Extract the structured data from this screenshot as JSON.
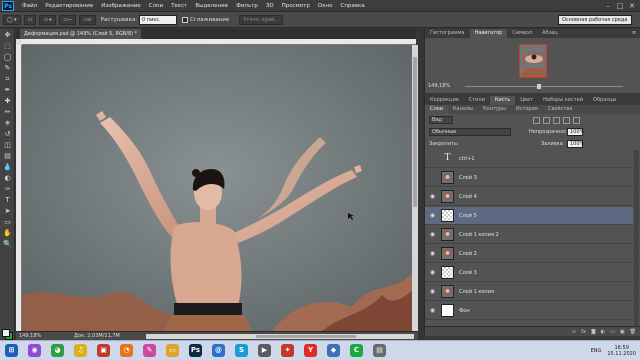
{
  "app": {
    "logo": "Ps"
  },
  "menu": [
    "Файл",
    "Редактирование",
    "Изображение",
    "Слои",
    "Текст",
    "Выделение",
    "Фильтр",
    "3D",
    "Просмотр",
    "Окно",
    "Справка"
  ],
  "window_controls": {
    "minimize": "–",
    "maximize": "□",
    "close": "✕"
  },
  "options_bar": {
    "feather_label": "Растушевка:",
    "feather_value": "0 пикс.",
    "antialias_label": "Сглаживание",
    "refine_label": "Уточн. край...",
    "workspace": "Основная рабочая среда"
  },
  "tools": [
    "move-icon",
    "marquee-icon",
    "lasso-icon",
    "quick-select-icon",
    "crop-icon",
    "eyedropper-icon",
    "heal-icon",
    "brush-icon",
    "stamp-icon",
    "history-brush-icon",
    "eraser-icon",
    "gradient-icon",
    "blur-icon",
    "dodge-icon",
    "pen-icon",
    "text-icon",
    "path-select-icon",
    "shape-icon",
    "hand-icon",
    "zoom-icon"
  ],
  "tool_glyphs": [
    "✥",
    "⬚",
    "◯",
    "✎",
    "⌗",
    "✒",
    "✚",
    "✏",
    "⎈",
    "↺",
    "◫",
    "▤",
    "💧",
    "◐",
    "✑",
    "T",
    "➤",
    "▭",
    "✋",
    "🔍"
  ],
  "document": {
    "tab_label": "Деформация.psd @ 149% (Слой 5, RGB/8) *",
    "zoom": "149,18%",
    "doc_info": "Док: 2,03М/11,7М"
  },
  "navigator": {
    "tabs": [
      "Гистограмма",
      "Навигатор",
      "Символ",
      "Абзац"
    ],
    "active_tab": 1,
    "zoom": "149,18%"
  },
  "layers": {
    "tabs": [
      "Коррекция",
      "Стили",
      "Кисть",
      "Цвет",
      "Наборы кистей",
      "Образцы"
    ],
    "active_tab": 2,
    "subtabs": [
      "Слои",
      "Каналы",
      "Контуры",
      "История",
      "Свойства"
    ],
    "active_subtab": 0,
    "filter_kind": "Вид",
    "blend_mode": "Обычные",
    "opacity_label": "Непрозрачность:",
    "opacity_value": "100%",
    "lock_label": "Закрепить:",
    "fill_label": "Заливка:",
    "fill_value": "100%",
    "items": [
      {
        "name": "ctrl+1",
        "thumb": "text",
        "visible": false,
        "selected": false
      },
      {
        "name": "Слой 3",
        "thumb": "photo",
        "visible": false,
        "selected": false
      },
      {
        "name": "Слой 4",
        "thumb": "photo",
        "visible": true,
        "selected": false
      },
      {
        "name": "Слой 5",
        "thumb": "chk",
        "visible": true,
        "selected": true
      },
      {
        "name": "Слой 1 копия 2",
        "thumb": "photo",
        "visible": true,
        "selected": false
      },
      {
        "name": "Слой 2",
        "thumb": "photo",
        "visible": true,
        "selected": false
      },
      {
        "name": "Слой 3",
        "thumb": "chk",
        "visible": true,
        "selected": false
      },
      {
        "name": "Слой 1 копия",
        "thumb": "photo",
        "visible": true,
        "selected": false
      },
      {
        "name": "Фон",
        "thumb": "white",
        "visible": true,
        "selected": false
      }
    ],
    "text_thumb_glyph": "T"
  },
  "taskbar": {
    "icons": [
      {
        "name": "start-icon",
        "glyph": "⊞",
        "color": "#1f5fb3"
      },
      {
        "name": "alice-icon",
        "glyph": "◉",
        "color": "#8d4bd8"
      },
      {
        "name": "chrome-icon",
        "glyph": "◕",
        "color": "#2f9e44"
      },
      {
        "name": "music-icon",
        "glyph": "♫",
        "color": "#d8b21a"
      },
      {
        "name": "image-viewer-icon",
        "glyph": "▣",
        "color": "#c0392b"
      },
      {
        "name": "firefox-icon",
        "glyph": "◔",
        "color": "#e8741a"
      },
      {
        "name": "paint-icon",
        "glyph": "✎",
        "color": "#c94aa0"
      },
      {
        "name": "explorer-icon",
        "glyph": "▭",
        "color": "#e0a526"
      },
      {
        "name": "photoshop-icon",
        "glyph": "Ps",
        "color": "#0b2b44"
      },
      {
        "name": "mail-icon",
        "glyph": "@",
        "color": "#2a73c9"
      },
      {
        "name": "skype-icon",
        "glyph": "S",
        "color": "#1a9bd6"
      },
      {
        "name": "media-icon",
        "glyph": "▶",
        "color": "#5a5a5a"
      },
      {
        "name": "app-icon",
        "glyph": "✦",
        "color": "#c0392b"
      },
      {
        "name": "yandex-icon",
        "glyph": "Y",
        "color": "#e02b2b"
      },
      {
        "name": "player-icon",
        "glyph": "◆",
        "color": "#3f6fb5"
      },
      {
        "name": "recorder-icon",
        "glyph": "C",
        "color": "#1aa847"
      },
      {
        "name": "files-icon",
        "glyph": "▤",
        "color": "#6a6a6a"
      }
    ],
    "lang": "ENG",
    "time": "16:59",
    "date": "15.11.2020"
  }
}
